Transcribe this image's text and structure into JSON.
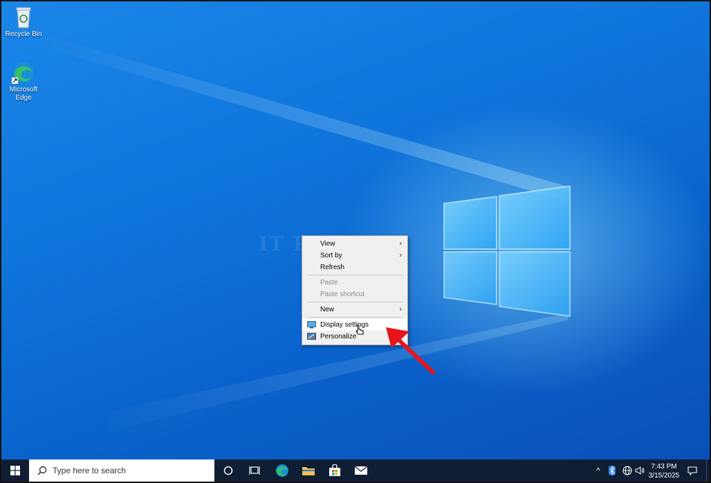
{
  "desktop": {
    "icons": [
      {
        "label": "Recycle Bin",
        "icon": "recycle-bin-icon"
      },
      {
        "label": "Microsoft Edge",
        "icon": "edge-icon"
      }
    ],
    "watermark": "IT Pros Hub"
  },
  "context_menu": {
    "items": [
      {
        "label": "View",
        "has_submenu": true,
        "disabled": false
      },
      {
        "label": "Sort by",
        "has_submenu": true,
        "disabled": false
      },
      {
        "label": "Refresh",
        "has_submenu": false,
        "disabled": false
      },
      {
        "label": "Paste",
        "has_submenu": false,
        "disabled": true
      },
      {
        "label": "Paste shortcut",
        "has_submenu": false,
        "disabled": true
      },
      {
        "label": "New",
        "has_submenu": true,
        "disabled": false
      },
      {
        "label": "Display settings",
        "has_submenu": false,
        "disabled": false,
        "icon": "display-icon",
        "highlighted": true
      },
      {
        "label": "Personalize",
        "has_submenu": false,
        "disabled": false,
        "icon": "personalize-icon"
      }
    ]
  },
  "taskbar": {
    "search_placeholder": "Type here to search",
    "time": "7:43 PM",
    "date": "3/15/2025"
  },
  "colors": {
    "desktop_blue": "#0f76dc",
    "taskbar": "#0f1e33",
    "menu_bg": "#f0f0f0",
    "annotation_red": "#e8141c"
  }
}
